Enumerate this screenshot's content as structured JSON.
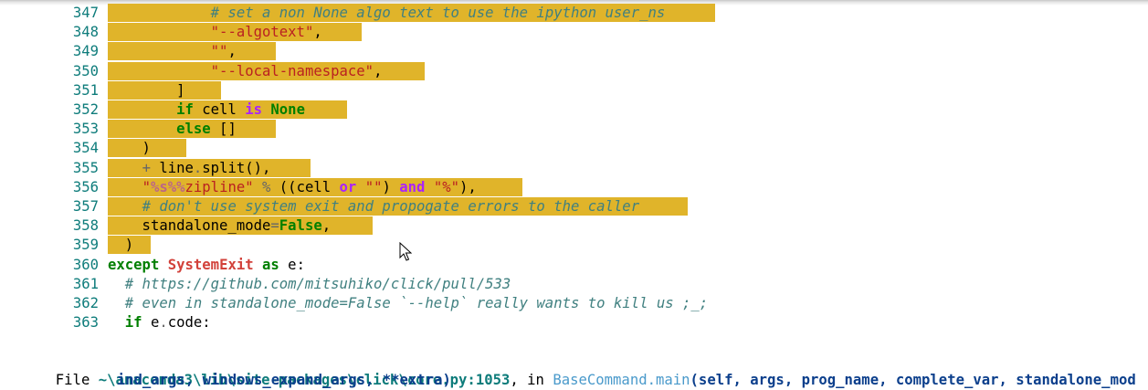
{
  "code_lines": [
    {
      "num": "347",
      "parts": [
        {
          "t": "            ",
          "c": ""
        },
        {
          "t": "# set a non None algo text to use the ipython user_ns",
          "c": "cm"
        }
      ]
    },
    {
      "num": "348",
      "parts": [
        {
          "t": "            ",
          "c": ""
        },
        {
          "t": "\"--algotext\"",
          "c": "str"
        },
        {
          "t": ",",
          "c": ""
        }
      ]
    },
    {
      "num": "349",
      "parts": [
        {
          "t": "            ",
          "c": ""
        },
        {
          "t": "\"\"",
          "c": "str"
        },
        {
          "t": ",",
          "c": ""
        }
      ]
    },
    {
      "num": "350",
      "parts": [
        {
          "t": "            ",
          "c": ""
        },
        {
          "t": "\"--local-namespace\"",
          "c": "str"
        },
        {
          "t": ",",
          "c": ""
        }
      ]
    },
    {
      "num": "351",
      "parts": [
        {
          "t": "        ]",
          "c": ""
        }
      ]
    },
    {
      "num": "352",
      "parts": [
        {
          "t": "        ",
          "c": ""
        },
        {
          "t": "if",
          "c": "kw"
        },
        {
          "t": " cell ",
          "c": ""
        },
        {
          "t": "is",
          "c": "ow"
        },
        {
          "t": " ",
          "c": ""
        },
        {
          "t": "None",
          "c": "kw"
        }
      ]
    },
    {
      "num": "353",
      "parts": [
        {
          "t": "        ",
          "c": ""
        },
        {
          "t": "else",
          "c": "kw"
        },
        {
          "t": " []",
          "c": ""
        }
      ]
    },
    {
      "num": "354",
      "parts": [
        {
          "t": "    )",
          "c": ""
        }
      ]
    },
    {
      "num": "355",
      "parts": [
        {
          "t": "    ",
          "c": ""
        },
        {
          "t": "+",
          "c": "op"
        },
        {
          "t": " line",
          "c": ""
        },
        {
          "t": ".",
          "c": "op"
        },
        {
          "t": "split(),",
          "c": ""
        }
      ]
    },
    {
      "num": "356",
      "parts": [
        {
          "t": "    ",
          "c": ""
        },
        {
          "t": "\"",
          "c": "str"
        },
        {
          "t": "%s%%",
          "c": "esc"
        },
        {
          "t": "zipline\"",
          "c": "str"
        },
        {
          "t": " ",
          "c": ""
        },
        {
          "t": "%",
          "c": "op"
        },
        {
          "t": " ((cell ",
          "c": ""
        },
        {
          "t": "or",
          "c": "ow"
        },
        {
          "t": " ",
          "c": ""
        },
        {
          "t": "\"\"",
          "c": "str"
        },
        {
          "t": ") ",
          "c": ""
        },
        {
          "t": "and",
          "c": "ow"
        },
        {
          "t": " ",
          "c": ""
        },
        {
          "t": "\"%\"",
          "c": "str"
        },
        {
          "t": "),",
          "c": ""
        }
      ]
    },
    {
      "num": "357",
      "parts": [
        {
          "t": "    ",
          "c": ""
        },
        {
          "t": "# don't use system exit and propogate errors to the caller",
          "c": "cm"
        }
      ]
    },
    {
      "num": "358",
      "parts": [
        {
          "t": "    standalone_mode",
          "c": ""
        },
        {
          "t": "=",
          "c": "op"
        },
        {
          "t": "False",
          "c": "kw"
        },
        {
          "t": ",",
          "c": ""
        }
      ]
    },
    {
      "num": "359",
      "parts": [
        {
          "t": "  )",
          "c": ""
        }
      ]
    },
    {
      "num": "360",
      "parts": [
        {
          "t": "except",
          "c": "kw"
        },
        {
          "t": " ",
          "c": ""
        },
        {
          "t": "SystemExit",
          "c": "exc"
        },
        {
          "t": " ",
          "c": ""
        },
        {
          "t": "as",
          "c": "kw"
        },
        {
          "t": " e:",
          "c": ""
        }
      ]
    },
    {
      "num": "361",
      "parts": [
        {
          "t": "  ",
          "c": ""
        },
        {
          "t": "# https://github.com/mitsuhiko/click/pull/533",
          "c": "url"
        }
      ]
    },
    {
      "num": "362",
      "parts": [
        {
          "t": "  ",
          "c": ""
        },
        {
          "t": "# even in standalone_mode=False `--help` really wants to kill us ;_;",
          "c": "cm"
        }
      ]
    },
    {
      "num": "363",
      "parts": [
        {
          "t": "  ",
          "c": ""
        },
        {
          "t": "if",
          "c": "kw"
        },
        {
          "t": " e",
          "c": ""
        },
        {
          "t": ".",
          "c": "op"
        },
        {
          "t": "code:",
          "c": ""
        }
      ]
    }
  ],
  "traceback": {
    "file_prefix": "File ",
    "path": "~\\anaconda3\\lib\\site-packages\\click\\core.py:1053",
    "in_text": ", in ",
    "func": "BaseCommand.main",
    "args": "(self, args, prog_name, complete_var, standalone_mod",
    "next": "       ind_args, windows_expand_args, **extra)"
  }
}
